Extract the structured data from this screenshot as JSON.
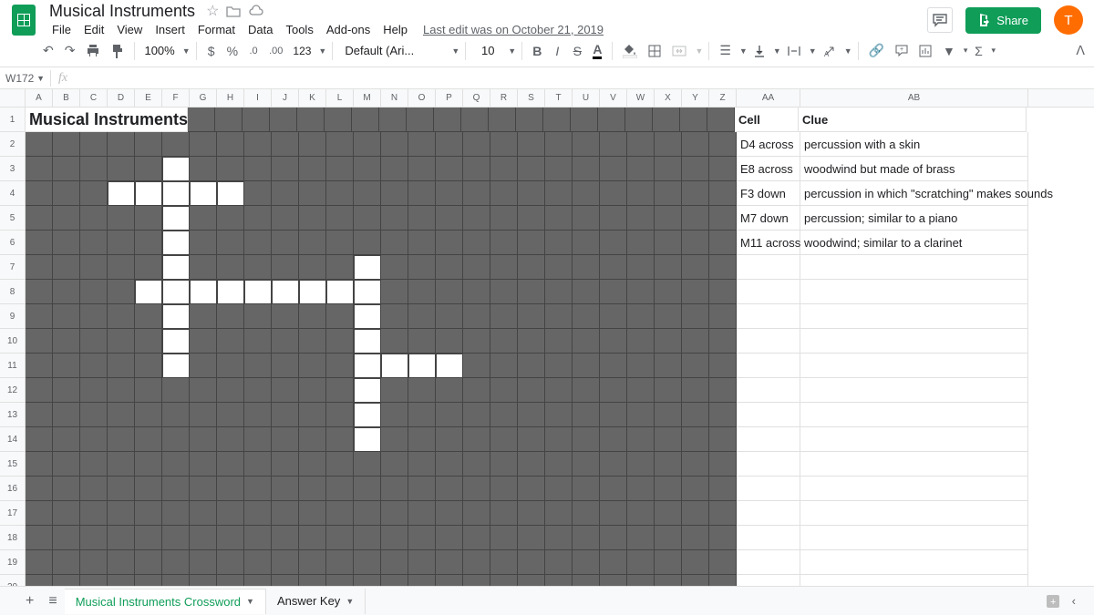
{
  "doc": {
    "title": "Musical Instruments",
    "last_edit": "Last edit was on October 21, 2019"
  },
  "menus": [
    "File",
    "Edit",
    "View",
    "Insert",
    "Format",
    "Data",
    "Tools",
    "Add-ons",
    "Help"
  ],
  "share": {
    "label": "Share"
  },
  "avatar": {
    "initial": "T"
  },
  "toolbar": {
    "zoom": "100%",
    "font": "Default (Ari...",
    "size": "10"
  },
  "name_box": "W172",
  "columns": [
    "A",
    "B",
    "C",
    "D",
    "E",
    "F",
    "G",
    "H",
    "I",
    "J",
    "K",
    "L",
    "M",
    "N",
    "O",
    "P",
    "Q",
    "R",
    "S",
    "T",
    "U",
    "V",
    "W",
    "X",
    "Y",
    "Z",
    "AA",
    "AB"
  ],
  "col_widths": {
    "default": 30,
    "AA": 70,
    "AB": 250
  },
  "rows": 20,
  "crossword": {
    "title": "Musical Instruments",
    "grey_range": {
      "cols": 26,
      "rows": 20
    },
    "white_cells": [
      [
        3,
        6
      ],
      [
        4,
        4
      ],
      [
        4,
        5
      ],
      [
        4,
        6
      ],
      [
        4,
        7
      ],
      [
        4,
        8
      ],
      [
        5,
        6
      ],
      [
        6,
        6
      ],
      [
        7,
        6
      ],
      [
        7,
        13
      ],
      [
        8,
        5
      ],
      [
        8,
        6
      ],
      [
        8,
        7
      ],
      [
        8,
        8
      ],
      [
        8,
        9
      ],
      [
        8,
        10
      ],
      [
        8,
        11
      ],
      [
        8,
        12
      ],
      [
        8,
        13
      ],
      [
        9,
        6
      ],
      [
        9,
        13
      ],
      [
        10,
        6
      ],
      [
        10,
        13
      ],
      [
        11,
        6
      ],
      [
        11,
        13
      ],
      [
        11,
        14
      ],
      [
        11,
        15
      ],
      [
        11,
        16
      ],
      [
        12,
        13
      ],
      [
        13,
        13
      ],
      [
        14,
        13
      ]
    ]
  },
  "clues": {
    "headers": {
      "cell": "Cell",
      "clue": "Clue"
    },
    "items": [
      {
        "cell": "D4 across",
        "clue": "percussion with a skin"
      },
      {
        "cell": "E8 across",
        "clue": "woodwind but made of brass"
      },
      {
        "cell": "F3 down",
        "clue": "percussion in which \"scratching\" makes sounds"
      },
      {
        "cell": "M7 down",
        "clue": "percussion; similar to a piano"
      },
      {
        "cell": "M11 across",
        "clue": "woodwind; similar to a clarinet"
      }
    ]
  },
  "tabs": [
    {
      "name": "Musical Instruments Crossword",
      "active": true
    },
    {
      "name": "Answer Key",
      "active": false
    }
  ]
}
